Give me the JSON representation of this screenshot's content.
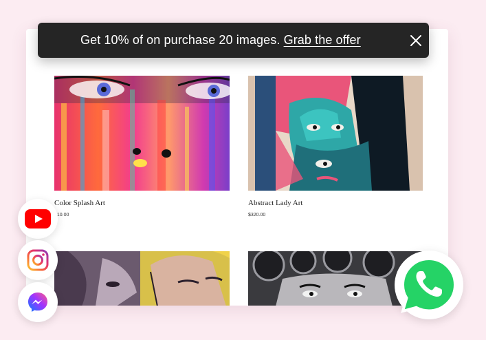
{
  "toast": {
    "message": "Get 10% of on purchase 20 images.",
    "link_label": "Grab the offer"
  },
  "products": [
    {
      "name": "Color Splash Art",
      "price": "$10.00"
    },
    {
      "name": "Abstract Lady Art",
      "price": "$320.00"
    },
    {
      "name": "",
      "price": ""
    },
    {
      "name": "",
      "price": ""
    }
  ],
  "social": {
    "icons": [
      "youtube-icon",
      "instagram-icon",
      "messenger-icon",
      "whatsapp-icon"
    ]
  },
  "colors": {
    "background": "#fcecf2",
    "toast_bg": "#252525",
    "youtube": "#ff0000",
    "whatsapp": "#25d366"
  }
}
